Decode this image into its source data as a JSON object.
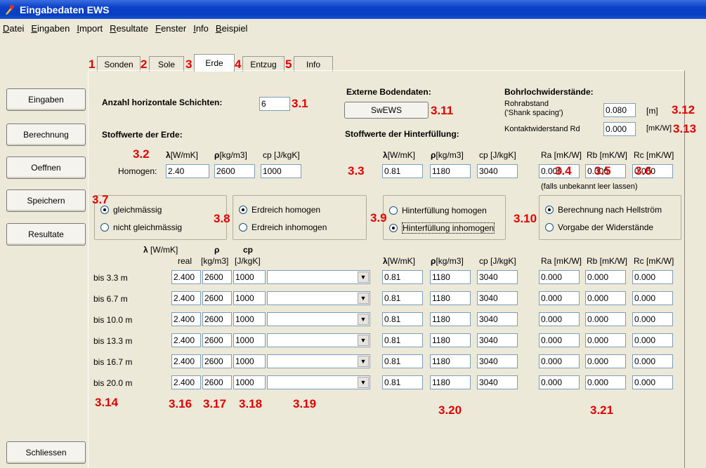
{
  "window": {
    "title": "Eingabedaten EWS"
  },
  "menu": [
    "Datei",
    "Eingaben",
    "Import",
    "Resultate",
    "Fenster",
    "Info",
    "Beispiel"
  ],
  "tabs": [
    {
      "num": "1",
      "label": "Sonden"
    },
    {
      "num": "2",
      "label": "Sole"
    },
    {
      "num": "3",
      "label": "Erde"
    },
    {
      "num": "4",
      "label": "Entzug"
    },
    {
      "num": "5",
      "label": "Info"
    }
  ],
  "sidebar": [
    "Eingaben",
    "Berechnung",
    "Oeffnen",
    "Speichern",
    "Resultate"
  ],
  "close_button": "Schliessen",
  "layers": {
    "label": "Anzahl horizontale Schichten:",
    "value": "6"
  },
  "soil": {
    "heading": "Stoffwerte der Erde:",
    "col1": "[W/mK]",
    "col2": "[kg/m3]",
    "col3": "cp [J/kgK]",
    "row_label": "Homogen:",
    "lambda": "2.40",
    "rho": "2600",
    "cp": "1000"
  },
  "external": {
    "heading": "Externe Bodendaten:",
    "button": "SwEWS"
  },
  "fill": {
    "heading": "Stoffwerte der Hinterfüllung:",
    "col1": "[W/mK]",
    "col2": "[kg/m3]",
    "col3": "cp [J/kgK]",
    "lambda": "0.81",
    "rho": "1180",
    "cp": "3040"
  },
  "borehole": {
    "heading": "Bohrlochwiderstände:",
    "spacing_label1": "Rohrabstand",
    "spacing_label2": "('Shank spacing')",
    "spacing_value": "0.080",
    "spacing_unit": "[m]",
    "contact_label": "Kontaktwiderstand Rd",
    "contact_value": "0.000",
    "contact_unit": "[mK/W]"
  },
  "resist": {
    "col1": "Ra [mK/W]",
    "col2": "Rb [mK/W]",
    "col3": "Rc [mK/W]",
    "ra": "0.000",
    "rb": "0.000",
    "rc": "0.000",
    "hint": "(falls unbekannt leer lassen)"
  },
  "radios": {
    "g1": [
      "gleichmässig",
      "nicht gleichmässig"
    ],
    "g2": [
      "Erdreich homogen",
      "Erdreich inhomogen"
    ],
    "g3": [
      "Hinterfüllung homogen",
      "Hinterfüllung inhomogen"
    ],
    "g4": [
      "Berechnung nach Hellström",
      "Vorgabe der Widerstände"
    ]
  },
  "table": {
    "h_lambda": "[W/mK]",
    "h_lambda2": "real",
    "h_rho": "[kg/m3]",
    "h_cp": "cp",
    "h_cp2": "[J/kgK]",
    "h_fl": "[W/mK]",
    "h_frho": "[kg/m3]",
    "h_fcp": "cp [J/kgK]",
    "h_ra": "Ra [mK/W]",
    "h_rb": "Rb [mK/W]",
    "h_rc": "Rc [mK/W]",
    "rows": [
      {
        "label": "bis 3.3 m",
        "l": "2.400",
        "rho": "2600",
        "cp": "1000",
        "fl": "0.81",
        "frho": "1180",
        "fcp": "3040",
        "ra": "0.000",
        "rb": "0.000",
        "rc": "0.000"
      },
      {
        "label": "bis 6.7 m",
        "l": "2.400",
        "rho": "2600",
        "cp": "1000",
        "fl": "0.81",
        "frho": "1180",
        "fcp": "3040",
        "ra": "0.000",
        "rb": "0.000",
        "rc": "0.000"
      },
      {
        "label": "bis 10.0 m",
        "l": "2.400",
        "rho": "2600",
        "cp": "1000",
        "fl": "0.81",
        "frho": "1180",
        "fcp": "3040",
        "ra": "0.000",
        "rb": "0.000",
        "rc": "0.000"
      },
      {
        "label": "bis 13.3 m",
        "l": "2.400",
        "rho": "2600",
        "cp": "1000",
        "fl": "0.81",
        "frho": "1180",
        "fcp": "3040",
        "ra": "0.000",
        "rb": "0.000",
        "rc": "0.000"
      },
      {
        "label": "bis 16.7 m",
        "l": "2.400",
        "rho": "2600",
        "cp": "1000",
        "fl": "0.81",
        "frho": "1180",
        "fcp": "3040",
        "ra": "0.000",
        "rb": "0.000",
        "rc": "0.000"
      },
      {
        "label": "bis 20.0 m",
        "l": "2.400",
        "rho": "2600",
        "cp": "1000",
        "fl": "0.81",
        "frho": "1180",
        "fcp": "3040",
        "ra": "0.000",
        "rb": "0.000",
        "rc": "0.000"
      }
    ]
  },
  "annotations": {
    "a31": "3.1",
    "a32": "3.2",
    "a33": "3.3",
    "a34": "3.4",
    "a35": "3.5",
    "a36": "3.6",
    "a37": "3.7",
    "a38": "3.8",
    "a39": "3.9",
    "a310": "3.10",
    "a311": "3.11",
    "a312": "3.12",
    "a313": "3.13",
    "a314": "3.14",
    "a316": "3.16",
    "a317": "3.17",
    "a318": "3.18",
    "a319": "3.19",
    "a320": "3.20",
    "a321": "3.21"
  },
  "colors": {
    "annotation": "#e00000",
    "titlebar": "#0a3fc8"
  }
}
